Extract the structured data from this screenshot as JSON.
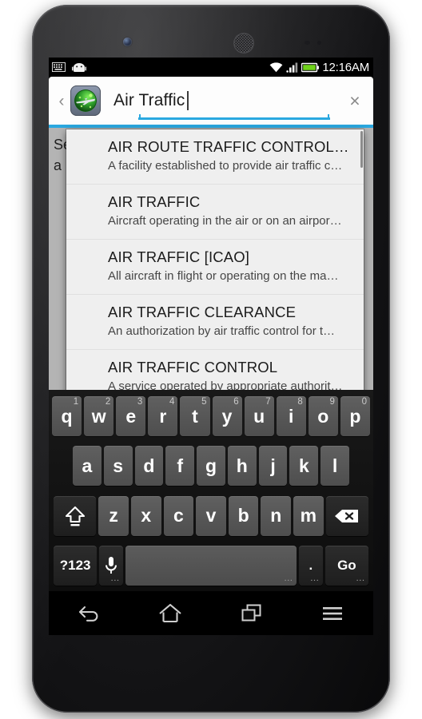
{
  "device": {
    "type": "android-phone"
  },
  "status_bar": {
    "left_icons": [
      "keyboard-icon",
      "android-robot-icon"
    ],
    "right_icons": [
      "wifi-icon",
      "cellular-signal-icon",
      "battery-icon"
    ],
    "clock": "12:16AM",
    "battery_color": "#6fd21a"
  },
  "search_bar": {
    "back_chevron": "‹",
    "app_icon": "radar-airplane-icon",
    "query": "Air Traffic",
    "clear_label": "×",
    "accent_color": "#2aa8e0"
  },
  "page_behind": {
    "line1": "Se",
    "line2": "a"
  },
  "suggestions": [
    {
      "title": "AIR ROUTE TRAFFIC CONTROL…",
      "desc": "A facility established to provide air traffic c…"
    },
    {
      "title": "AIR TRAFFIC",
      "desc": "Aircraft operating in the air or on an airpor…"
    },
    {
      "title": "AIR TRAFFIC [ICAO]",
      "desc": "All aircraft in flight or operating on the ma…"
    },
    {
      "title": "AIR TRAFFIC CLEARANCE",
      "desc": "An authorization by air traffic control for t…"
    },
    {
      "title": "AIR TRAFFIC CONTROL",
      "desc": "A service operated by appropriate authorit…"
    }
  ],
  "keyboard": {
    "row1": [
      {
        "key": "q",
        "hint": "1"
      },
      {
        "key": "w",
        "hint": "2"
      },
      {
        "key": "e",
        "hint": "3"
      },
      {
        "key": "r",
        "hint": "4"
      },
      {
        "key": "t",
        "hint": "5"
      },
      {
        "key": "y",
        "hint": "6"
      },
      {
        "key": "u",
        "hint": "7"
      },
      {
        "key": "i",
        "hint": "8"
      },
      {
        "key": "o",
        "hint": "9"
      },
      {
        "key": "p",
        "hint": "0"
      }
    ],
    "row2": [
      {
        "key": "a"
      },
      {
        "key": "s"
      },
      {
        "key": "d"
      },
      {
        "key": "f"
      },
      {
        "key": "g"
      },
      {
        "key": "h"
      },
      {
        "key": "j"
      },
      {
        "key": "k"
      },
      {
        "key": "l"
      }
    ],
    "row3": [
      {
        "key": "z"
      },
      {
        "key": "x"
      },
      {
        "key": "c"
      },
      {
        "key": "v"
      },
      {
        "key": "b"
      },
      {
        "key": "n"
      },
      {
        "key": "m"
      }
    ],
    "shift_label": "shift-icon",
    "backspace_label": "backspace-icon",
    "symbols_label": "?123",
    "mic_label": "microphone-icon",
    "space_label": "",
    "period_label": ".",
    "enter_label": "Go"
  },
  "navbar": {
    "back": "back-icon",
    "home": "home-icon",
    "recents": "recents-icon",
    "menu": "menu-icon"
  }
}
